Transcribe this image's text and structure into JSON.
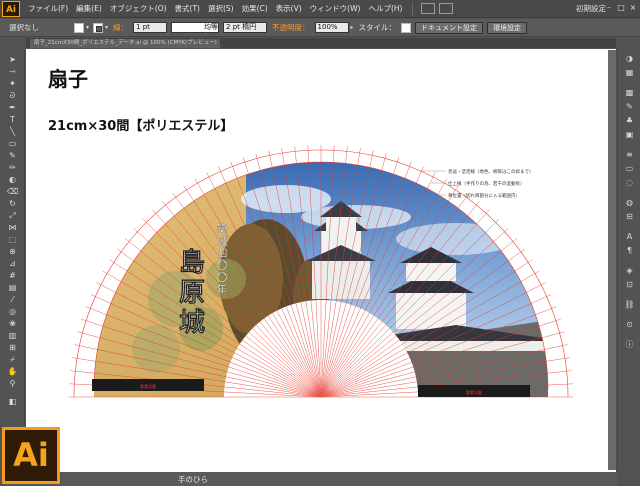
{
  "menubar": {
    "app_logo": "Ai",
    "items": [
      "ファイル(F)",
      "編集(E)",
      "オブジェクト(O)",
      "書式(T)",
      "選択(S)",
      "効果(C)",
      "表示(V)",
      "ウィンドウ(W)",
      "ヘルプ(H)"
    ],
    "workspace": "初期設定"
  },
  "control_bar": {
    "selection": "選択なし",
    "stroke_label": "線：",
    "stroke_weight": "1 pt",
    "stroke_profile": "均等",
    "brush": "2 pt 楕円",
    "opacity_label": "不透明度：",
    "opacity_value": "100%",
    "style_label": "スタイル：",
    "doc_setup": "ドキュメント設定",
    "prefs": "環境設定"
  },
  "document_tab": {
    "title": "扇子_21cmX30間_ポリエステル_データ.ai @ 100% (CMYK/プレビュー)"
  },
  "artboard": {
    "title": "扇子",
    "subtitle": "21cm×30間【ポリエステル】"
  },
  "fan": {
    "vertical_main": "島原城",
    "vertical_sub": "築城四〇〇年",
    "legend": [
      "見返・塗足線（地色、柄等はこの枠まで）",
      "仕上線（手作りの為、若干の変動有）",
      "骨位置（切れ目部分に入る範囲内）"
    ],
    "footer_label": "要素記載"
  },
  "status": {
    "tool": "手のひら"
  },
  "colors": {
    "accent": "#f7a21b",
    "guide_red": "#e83a2e",
    "fan_gold": "#d9b069",
    "sky": "#4a7ec0"
  }
}
